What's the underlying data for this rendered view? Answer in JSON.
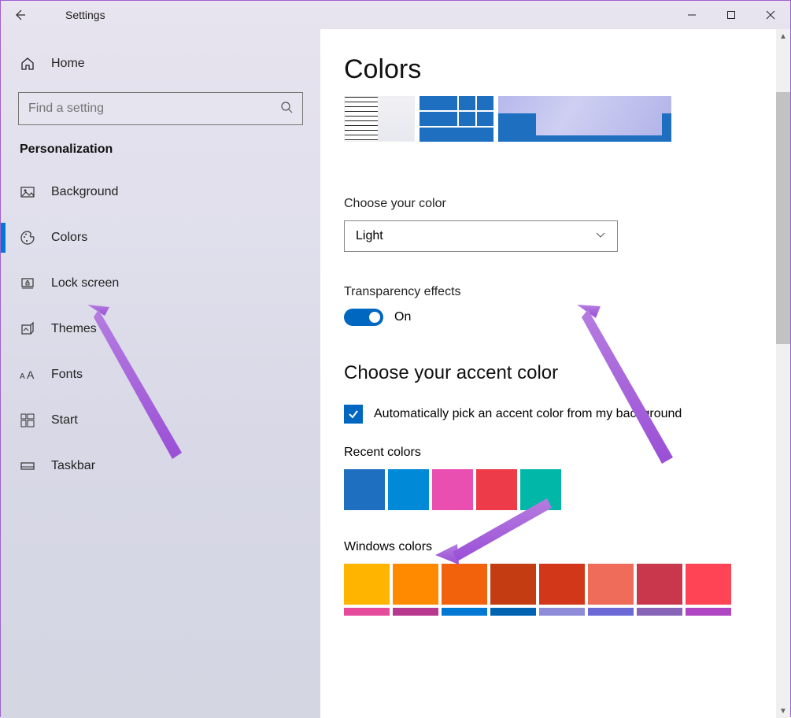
{
  "window": {
    "title": "Settings"
  },
  "sidebar": {
    "home": "Home",
    "search_placeholder": "Find a setting",
    "category": "Personalization",
    "items": [
      {
        "icon": "image-icon",
        "label": "Background",
        "active": false
      },
      {
        "icon": "palette-icon",
        "label": "Colors",
        "active": true
      },
      {
        "icon": "lock-icon",
        "label": "Lock screen",
        "active": false
      },
      {
        "icon": "themes-icon",
        "label": "Themes",
        "active": false
      },
      {
        "icon": "fonts-icon",
        "label": "Fonts",
        "active": false
      },
      {
        "icon": "start-icon",
        "label": "Start",
        "active": false
      },
      {
        "icon": "taskbar-icon",
        "label": "Taskbar",
        "active": false
      }
    ]
  },
  "content": {
    "page_title": "Colors",
    "choose_color_label": "Choose your color",
    "choose_color_value": "Light",
    "transparency_label": "Transparency effects",
    "transparency_state": "On",
    "accent_heading": "Choose your accent color",
    "auto_accent_label": "Automatically pick an accent color from my background",
    "auto_accent_checked": true,
    "recent_colors_label": "Recent colors",
    "recent_colors": [
      "#1f6fc0",
      "#0089d6",
      "#e84fb0",
      "#ee3b4a",
      "#00b7a8"
    ],
    "windows_colors_label": "Windows colors",
    "windows_colors_row1": [
      "#ffb400",
      "#ff8a00",
      "#f2610c",
      "#c43d12",
      "#d2371a",
      "#ef6b5a",
      "#c9374c",
      "#ff4455"
    ],
    "windows_colors_row2": [
      "#e64a9b",
      "#b8388f",
      "#0078d4",
      "#0063b1",
      "#8e8cd8",
      "#6b69d6",
      "#8764b8",
      "#b146c2"
    ]
  }
}
